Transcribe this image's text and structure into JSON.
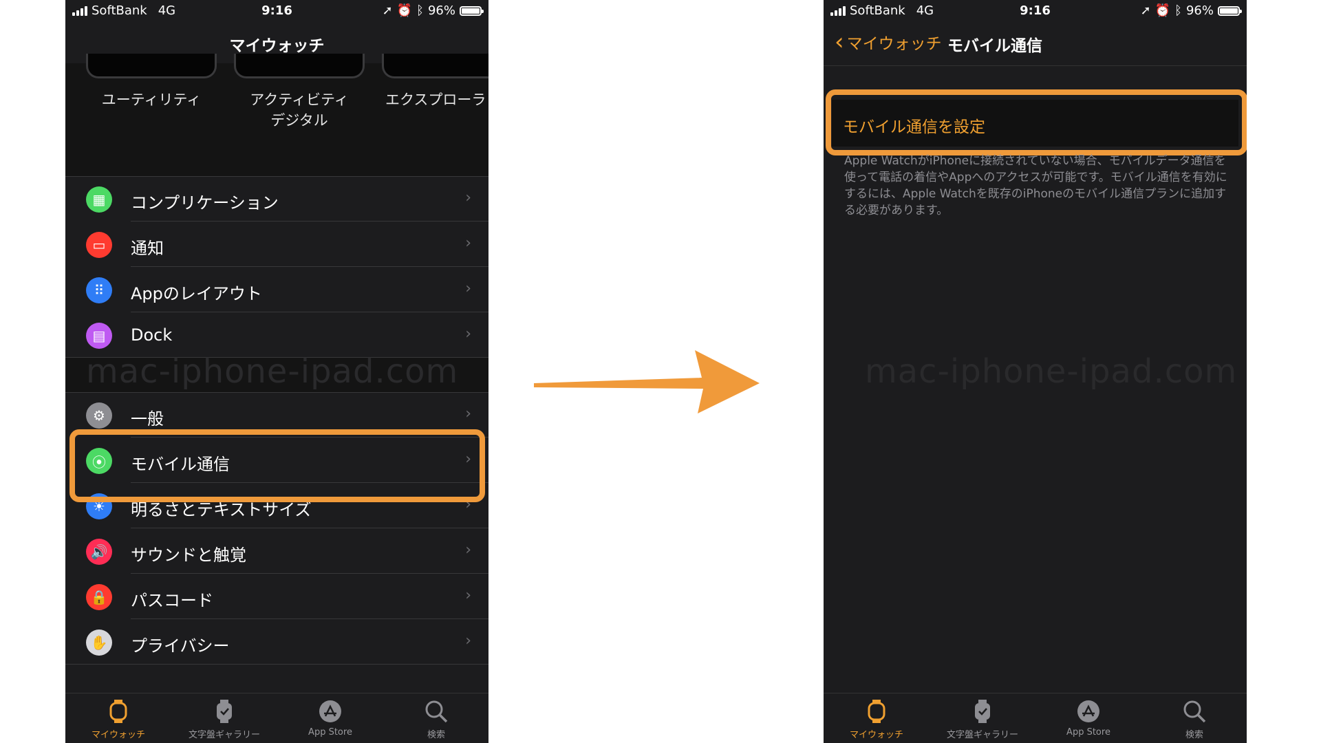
{
  "status": {
    "carrier": "SoftBank",
    "network": "4G",
    "time": "9:16",
    "battery": "96%",
    "battery_level": 0.96
  },
  "left": {
    "title": "マイウォッチ",
    "faces": [
      "ユーティリティ",
      "アクティビティ\nデジタル",
      "エクスプローラ"
    ],
    "group1": [
      {
        "label": "コンプリケーション",
        "icon": "complications-icon",
        "color": "#4cd964"
      },
      {
        "label": "通知",
        "icon": "notifications-icon",
        "color": "#ff3b30"
      },
      {
        "label": "Appのレイアウト",
        "icon": "app-layout-icon",
        "color": "#2f7df6"
      },
      {
        "label": "Dock",
        "icon": "dock-icon",
        "color": "#bf5af2"
      }
    ],
    "group2": [
      {
        "label": "一般",
        "icon": "gear-icon",
        "color": "#8e8e93"
      },
      {
        "label": "モバイル通信",
        "icon": "cellular-icon",
        "color": "#4cd964"
      },
      {
        "label": "明るさとテキストサイズ",
        "icon": "brightness-icon",
        "color": "#2f7df6"
      },
      {
        "label": "サウンドと触覚",
        "icon": "sound-icon",
        "color": "#ff2d55"
      },
      {
        "label": "パスコード",
        "icon": "lock-icon",
        "color": "#ff3b30"
      },
      {
        "label": "プライバシー",
        "icon": "hand-icon",
        "color": "#d8d8dc"
      }
    ]
  },
  "right": {
    "back": "マイウォッチ",
    "title": "モバイル通信",
    "setup": "モバイル通信を設定",
    "description": "Apple WatchがiPhoneに接続されていない場合、モバイルデータ通信を使って電話の着信やAppへのアクセスが可能です。モバイル通信を有効にするには、Apple Watchを既存のiPhoneのモバイル通信プランに追加する必要があります。"
  },
  "tabs": [
    "マイウォッチ",
    "文字盤ギャラリー",
    "App Store",
    "検索"
  ],
  "watermark": "mac-iphone-ipad.com",
  "colors": {
    "accent": "#f0a030",
    "highlight": "#ef9a3b",
    "arrow": "#f09a3a"
  }
}
